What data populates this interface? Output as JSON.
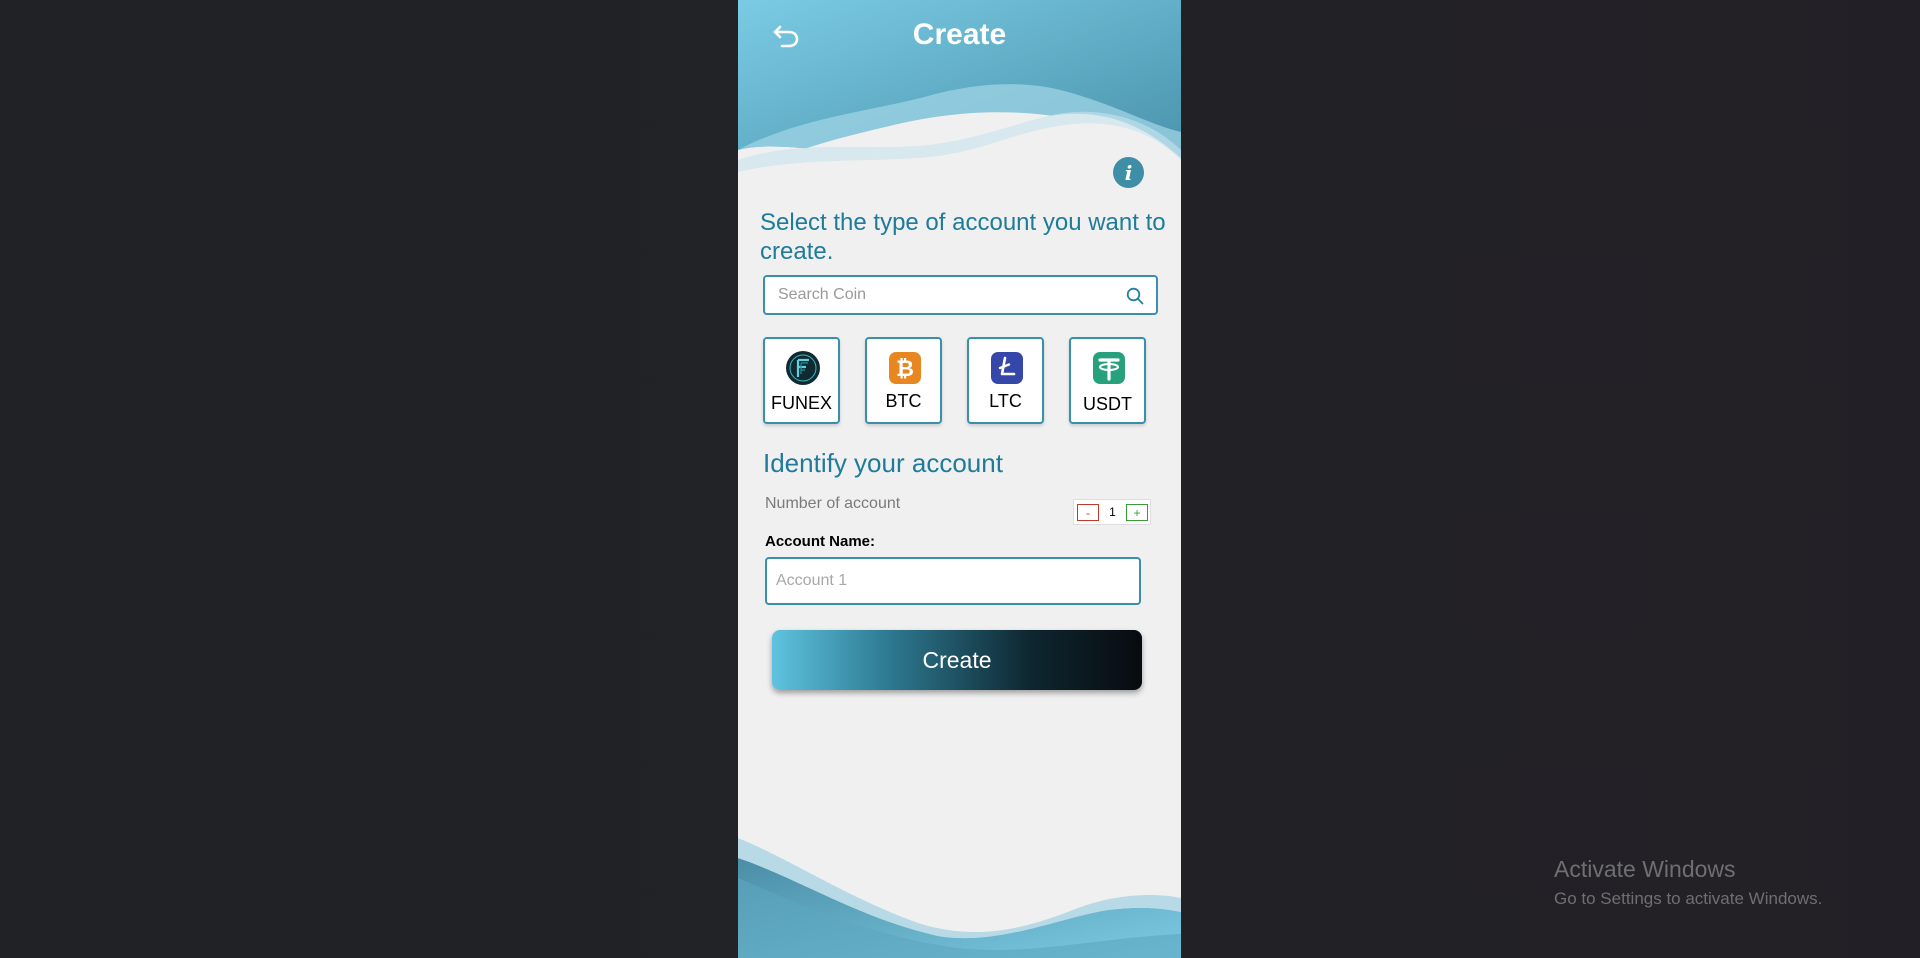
{
  "header": {
    "title": "Create",
    "back_icon": "undo-arrow-icon"
  },
  "info_icon": "info-icon",
  "select_section": {
    "title": "Select the type of account you want to create.",
    "search_placeholder": "Search Coin",
    "search_icon": "search-icon"
  },
  "coins": [
    {
      "label": "FUNEX",
      "icon": "funex-logo-icon",
      "color": "#0f2a30"
    },
    {
      "label": "BTC",
      "icon": "bitcoin-icon",
      "color": "#e8861f"
    },
    {
      "label": "LTC",
      "icon": "litecoin-icon",
      "color": "#3547a8"
    },
    {
      "label": "USDT",
      "icon": "tether-icon",
      "color": "#26a17b"
    }
  ],
  "identify_section": {
    "title": "Identify your account",
    "number_label": "Number of account",
    "stepper": {
      "minus": "-",
      "value": "1",
      "plus": "+"
    },
    "account_name_label": "Account Name:",
    "account_name_placeholder": "Account 1"
  },
  "create_button_label": "Create",
  "windows_watermark": {
    "title": "Activate Windows",
    "subtitle": "Go to Settings to activate Windows."
  },
  "colors": {
    "accent": "#1f7b9a",
    "border": "#3a8fae",
    "wave_light": "#7ccbe3",
    "wave_dark": "#4a9ab3"
  }
}
